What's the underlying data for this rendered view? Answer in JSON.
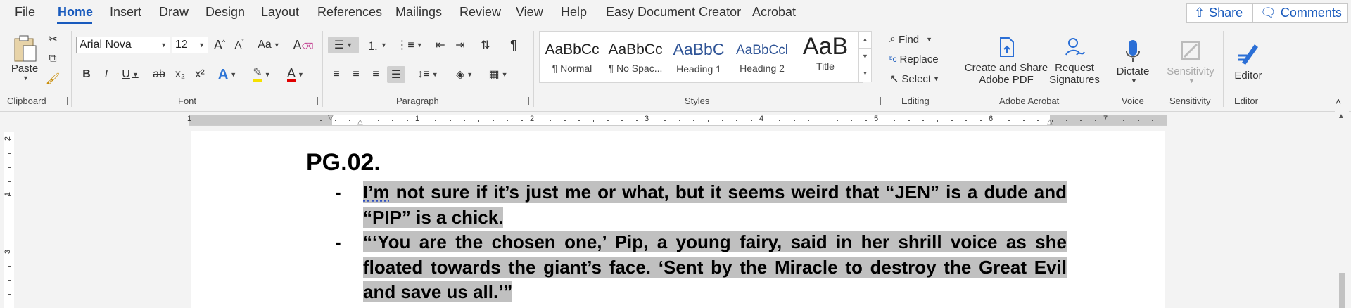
{
  "menu": {
    "tabs": [
      "File",
      "Home",
      "Insert",
      "Draw",
      "Design",
      "Layout",
      "References",
      "Mailings",
      "Review",
      "View",
      "Help",
      "Easy Document Creator",
      "Acrobat"
    ],
    "share": "Share",
    "comments": "Comments"
  },
  "clipboard": {
    "paste": "Paste",
    "label": "Clipboard"
  },
  "font": {
    "name": "Arial Nova",
    "size": "12",
    "change_case": "Aa",
    "bold": "B",
    "italic": "I",
    "underline": "U",
    "strike": "ab",
    "subscript": "x₂",
    "superscript": "x²",
    "text_effects": "A",
    "font_color": "A",
    "label": "Font",
    "highlight_color": "#f5e000",
    "font_color_value": "#e00000"
  },
  "paragraph": {
    "label": "Paragraph",
    "pilcrow": "¶"
  },
  "styles": {
    "items": [
      {
        "sample": "AaBbCc",
        "name": "¶ Normal"
      },
      {
        "sample": "AaBbCc",
        "name": "¶ No Spac..."
      },
      {
        "sample": "AaBbC",
        "name": "Heading 1"
      },
      {
        "sample": "AaBbCcl",
        "name": "Heading 2"
      },
      {
        "sample": "AaB",
        "name": "Title"
      }
    ],
    "label": "Styles",
    "heading_color": "#2f5496"
  },
  "editing": {
    "find": "Find",
    "replace": "Replace",
    "select": "Select",
    "label": "Editing"
  },
  "acrobat": {
    "create_line1": "Create and Share",
    "create_line2": "Adobe PDF",
    "request_line1": "Request",
    "request_line2": "Signatures",
    "label": "Adobe Acrobat"
  },
  "voice": {
    "dictate": "Dictate",
    "label": "Voice"
  },
  "sensitivity": {
    "button": "Sensitivity",
    "label": "Sensitivity"
  },
  "editor": {
    "button": "Editor",
    "label": "Editor"
  },
  "ruler": {
    "numbers": [
      "1",
      "1",
      "2",
      "3",
      "4",
      "5",
      "6",
      "7"
    ],
    "vertical_numbers": [
      "2",
      "1",
      "3"
    ]
  },
  "document": {
    "heading": "PG.02.",
    "bullets": [
      {
        "dash": "-",
        "word1": "I’m",
        "rest": " not sure if it’s just me or what, but it seems weird that “JEN” is a dude and “PIP” is a chick."
      },
      {
        "dash": "-",
        "text": "“‘You are the chosen one,’ Pip, a young fairy, said in her shrill voice as she floated towards the giant’s face. ‘Sent by the Miracle to destroy the Great Evil and save us all.’”"
      }
    ]
  },
  "colors": {
    "accent": "#185abd",
    "selection": "#c0c0c0"
  }
}
